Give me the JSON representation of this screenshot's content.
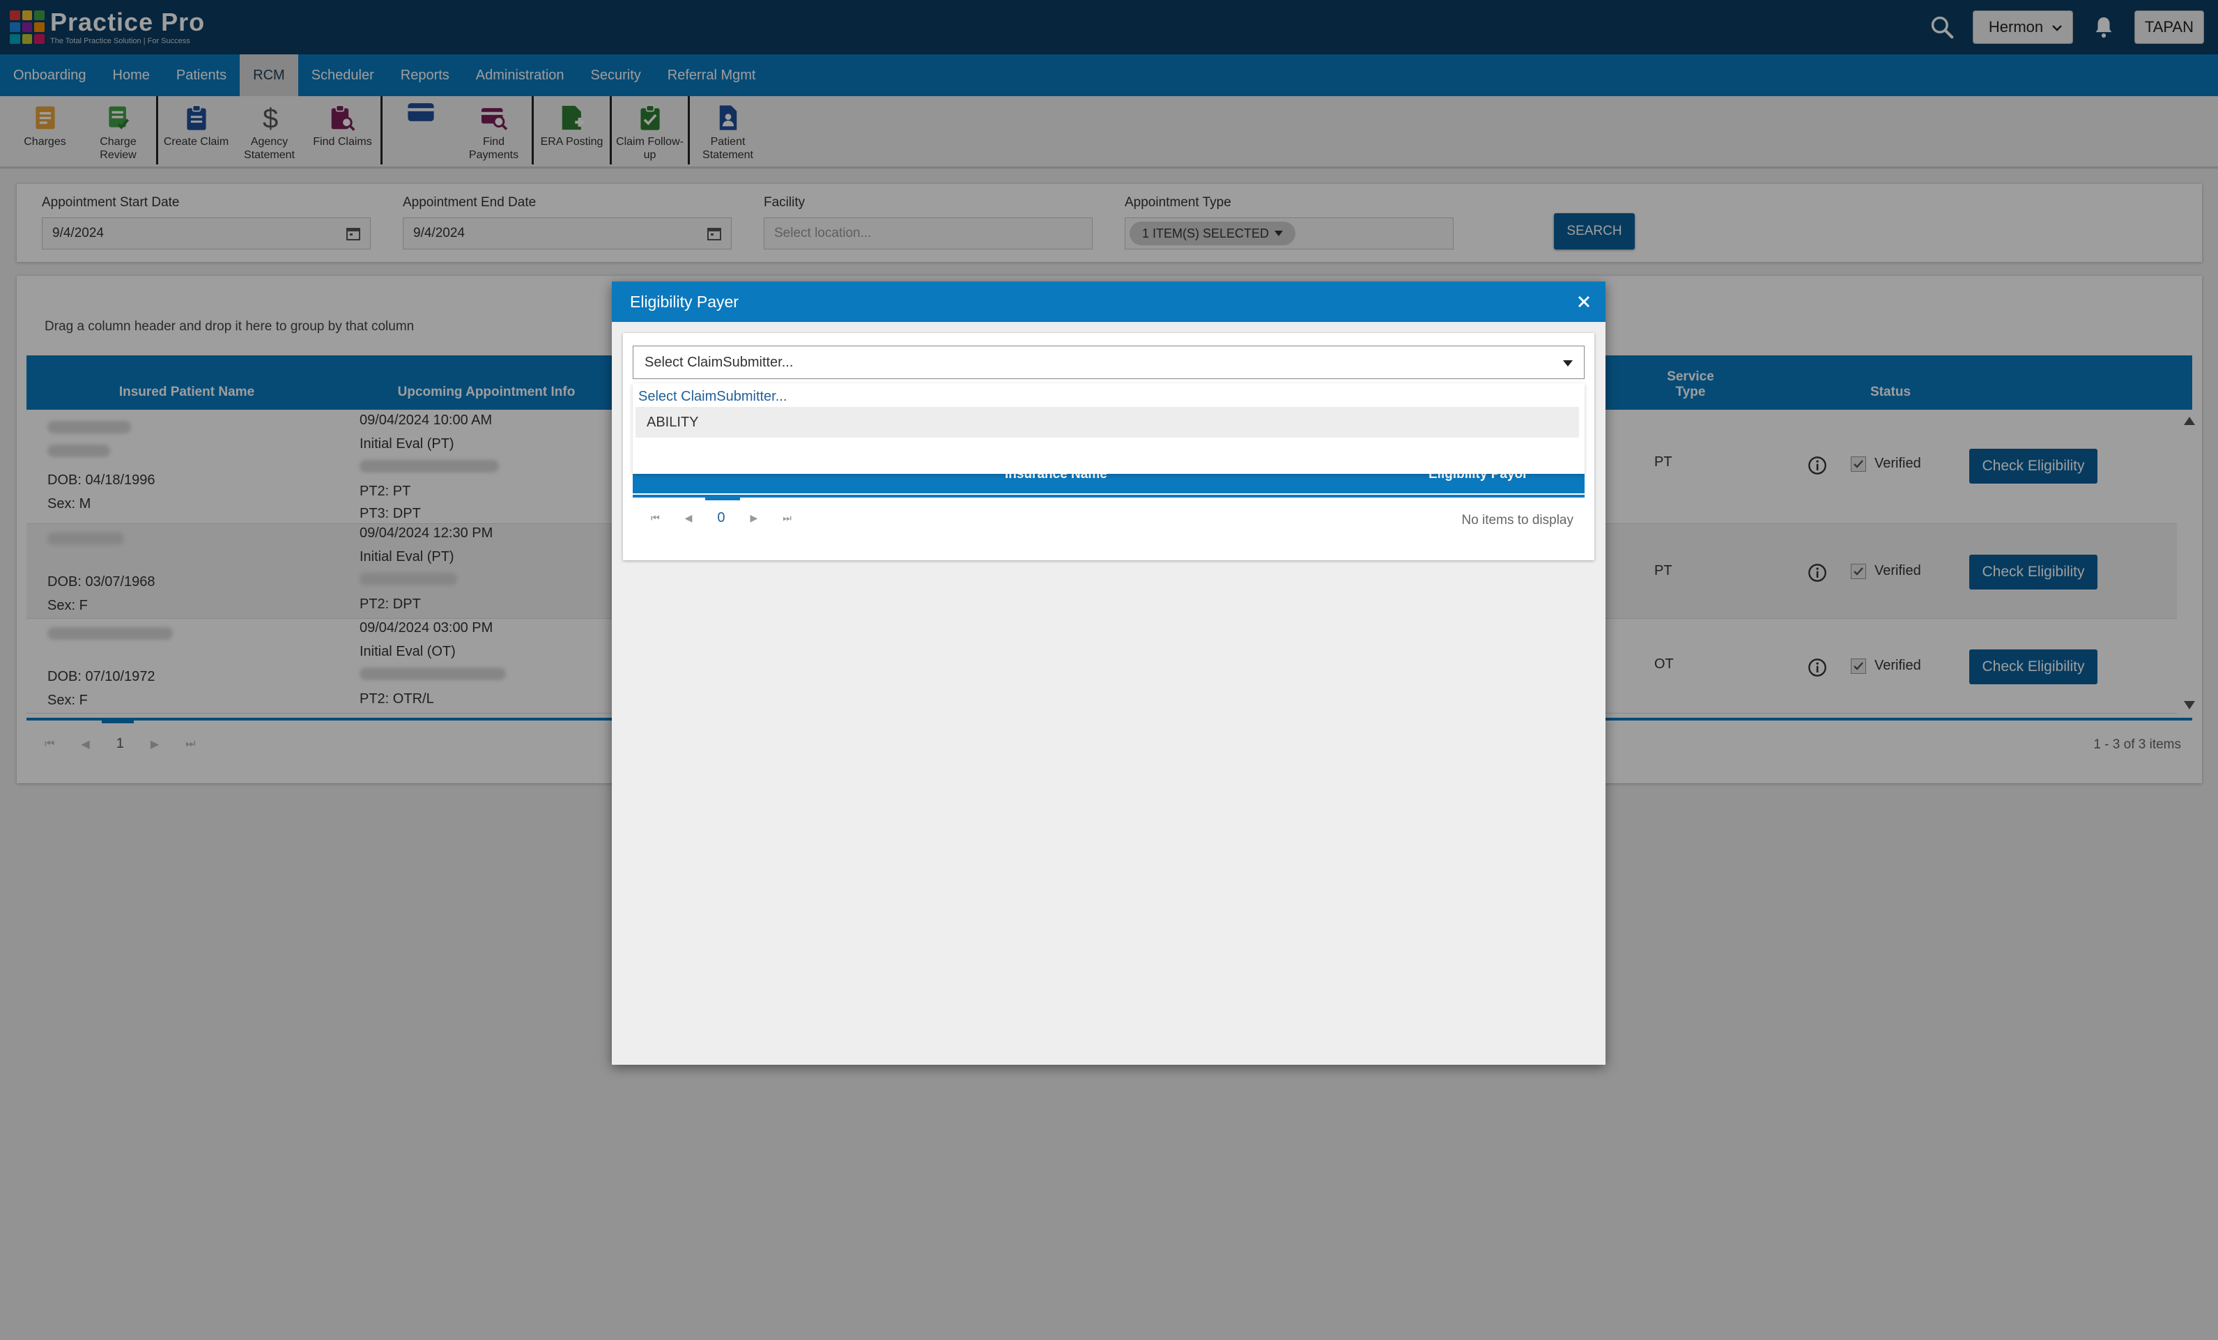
{
  "header": {
    "brand": "Practice Pro",
    "tagline": "The Total Practice Solution | For Success",
    "location": "Hermon",
    "user": "TAPAN"
  },
  "nav": {
    "items": [
      {
        "label": "Onboarding"
      },
      {
        "label": "Home"
      },
      {
        "label": "Patients"
      },
      {
        "label": "RCM",
        "active": true
      },
      {
        "label": "Scheduler"
      },
      {
        "label": "Reports"
      },
      {
        "label": "Administration"
      },
      {
        "label": "Security"
      },
      {
        "label": "Referral Mgmt"
      }
    ]
  },
  "toolbar": {
    "charges": "Charges",
    "charge_review": "Charge Review",
    "create_claim": "Create Claim",
    "agency_statement": "Agency Statement",
    "find_claims": "Find Claims",
    "find_payments": "Find Payments",
    "era_posting": "ERA Posting",
    "claim_followup": "Claim Follow-up",
    "patient_statement": "Patient Statement"
  },
  "filters": {
    "start_label": "Appointment Start Date",
    "start_value": "9/4/2024",
    "end_label": "Appointment End Date",
    "end_value": "9/4/2024",
    "facility_label": "Facility",
    "facility_placeholder": "Select location...",
    "type_label": "Appointment Type",
    "type_chip": "1 ITEM(S) SELECTED",
    "search": "SEARCH"
  },
  "grid": {
    "group_hint": "Drag a column header and drop it here to group by that column",
    "columns": {
      "patient": "Insured Patient Name",
      "appointment": "Upcoming Appointment Info",
      "service_type": "Service Type",
      "status": "Status"
    },
    "rows": [
      {
        "dob": "DOB: 04/18/1996",
        "sex": "Sex: M",
        "datetime": "09/04/2024 10:00 AM",
        "eval": "Initial Eval (PT)",
        "pt2": "PT2: PT",
        "pt3": "PT3: DPT",
        "service": "PT",
        "status": "Verified",
        "action": "Check Eligibility"
      },
      {
        "dob": "DOB: 03/07/1968",
        "sex": "Sex: F",
        "datetime": "09/04/2024 12:30 PM",
        "eval": "Initial Eval (PT)",
        "pt2": "PT2: DPT",
        "service": "PT",
        "status": "Verified",
        "action": "Check Eligibility"
      },
      {
        "dob": "DOB: 07/10/1972",
        "sex": "Sex: F",
        "datetime": "09/04/2024 03:00 PM",
        "eval": "Initial Eval (OT)",
        "pt2": "PT2: OTR/L",
        "service": "OT",
        "status": "Verified",
        "action": "Check Eligibility"
      }
    ],
    "page": "1",
    "count": "1 - 3 of 3 items"
  },
  "modal": {
    "title": "Eligibility Payer",
    "select_value": "Select ClaimSubmitter...",
    "dropdown_placeholder": "Select ClaimSubmitter...",
    "dropdown_option": "ABILITY",
    "col_insurance": "Insurance Name",
    "col_payor": "Eligibility Payor",
    "page": "0",
    "empty": "No items to display"
  },
  "colors": {
    "header_bg": "#0c3d63",
    "nav_bg": "#0b79be",
    "button_bg": "#0b5f99"
  }
}
